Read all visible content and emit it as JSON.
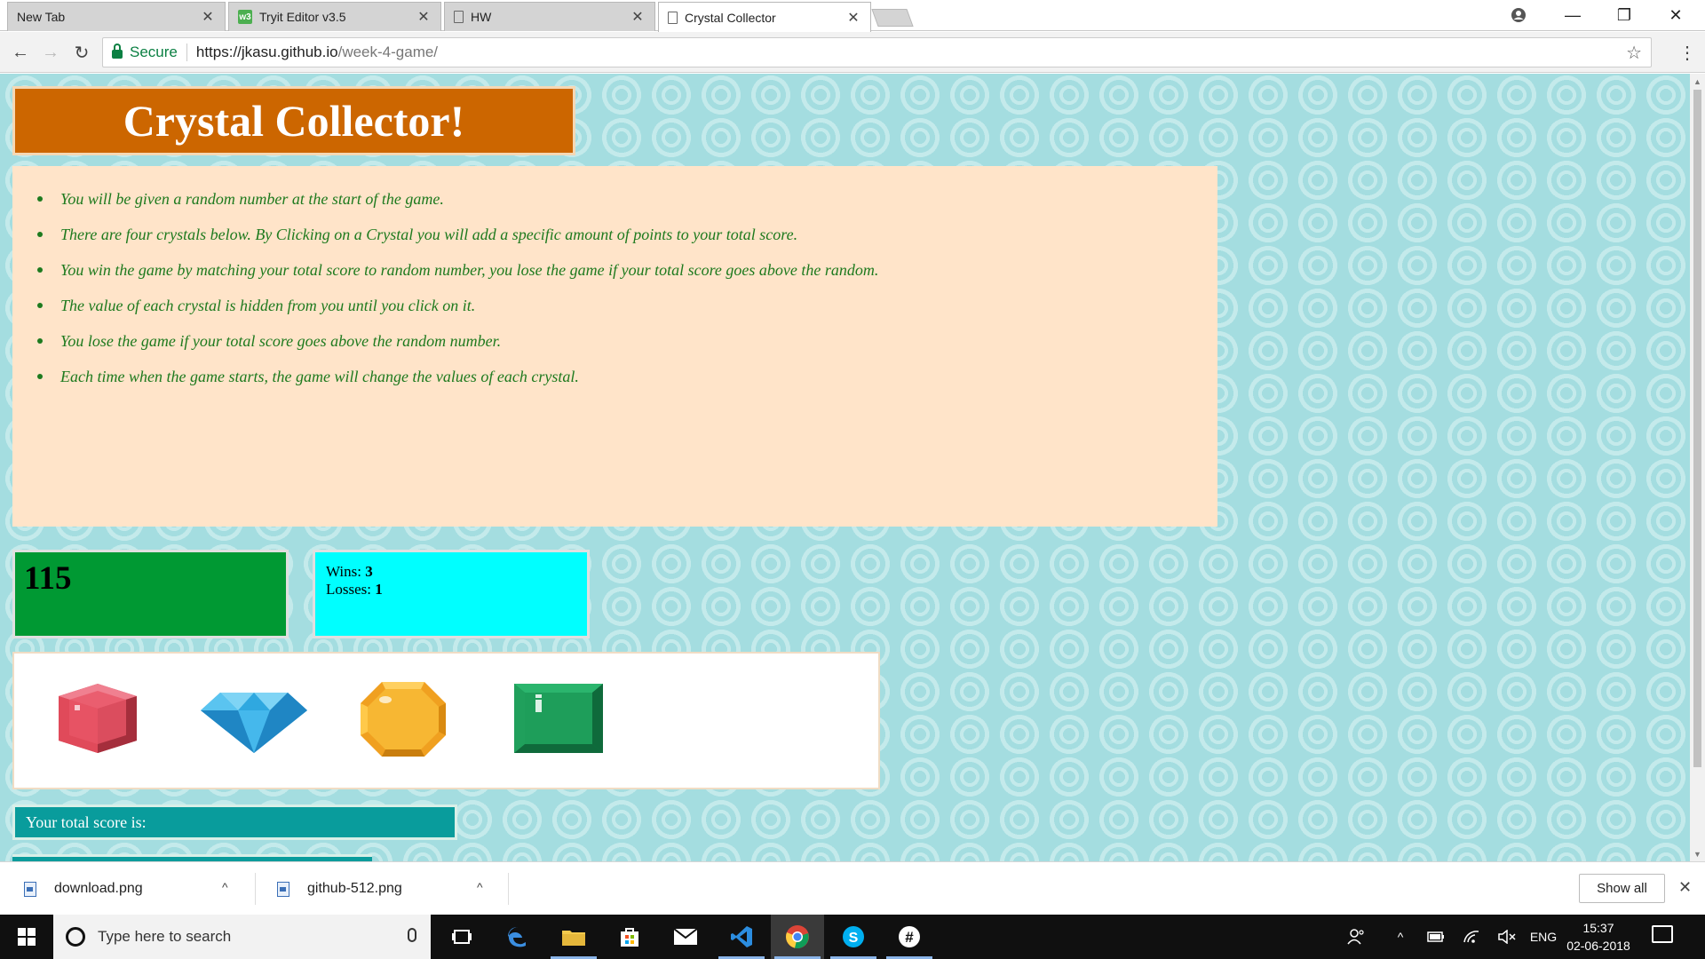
{
  "browser": {
    "tabs": [
      {
        "title": "New Tab",
        "favicon": "none",
        "active": false
      },
      {
        "title": "Tryit Editor v3.5",
        "favicon": "w3schools-icon",
        "active": false
      },
      {
        "title": "HW",
        "favicon": "page-icon",
        "active": false
      },
      {
        "title": "Crystal Collector",
        "favicon": "page-icon",
        "active": true
      }
    ],
    "address": {
      "secure_label": "Secure",
      "url_host": "https://jkasu.github.io",
      "url_path": "/week-4-game/"
    }
  },
  "page": {
    "title": "Crystal Collector!",
    "rules": [
      "You will be given a random number at the start of the game.",
      "There are four crystals below. By Clicking on a Crystal you will add a specific amount of points to your total score.",
      "You win the game by matching your total score to random number, you lose the game if your total score goes above the random.",
      "The value of each crystal is hidden from you until you click on it.",
      "You lose the game if your total score goes above the random number.",
      "Each time when the game starts, the game will change the values of each crystal."
    ],
    "target_number": "115",
    "stats": {
      "wins_label": "Wins: ",
      "wins": "3",
      "losses_label": "Losses: ",
      "losses": "1"
    },
    "crystals": [
      {
        "name": "red-crystal",
        "color": "#e04a5a"
      },
      {
        "name": "blue-diamond",
        "color": "#2fa8e0"
      },
      {
        "name": "yellow-crystal",
        "color": "#f7b733"
      },
      {
        "name": "green-crystal",
        "color": "#1e9e5a"
      }
    ],
    "score_label": "Your total score is:",
    "colors": {
      "title_bg": "#cc6600",
      "rules_bg": "#ffe4c9",
      "rules_text": "#1e7a1e",
      "target_bg": "#009933",
      "stats_bg": "#00ffff",
      "score_bg": "#099c9c",
      "page_pattern": "#a4dde0"
    }
  },
  "downloads": {
    "items": [
      {
        "filename": "download.png"
      },
      {
        "filename": "github-512.png"
      }
    ],
    "show_all": "Show all"
  },
  "taskbar": {
    "search_placeholder": "Type here to search",
    "apps": [
      "task-view-icon",
      "edge-icon",
      "file-explorer-icon",
      "store-icon",
      "mail-icon",
      "vscode-icon",
      "chrome-icon",
      "skype-icon",
      "slack-icon"
    ],
    "language": "ENG",
    "time": "15:37",
    "date": "02-06-2018"
  }
}
